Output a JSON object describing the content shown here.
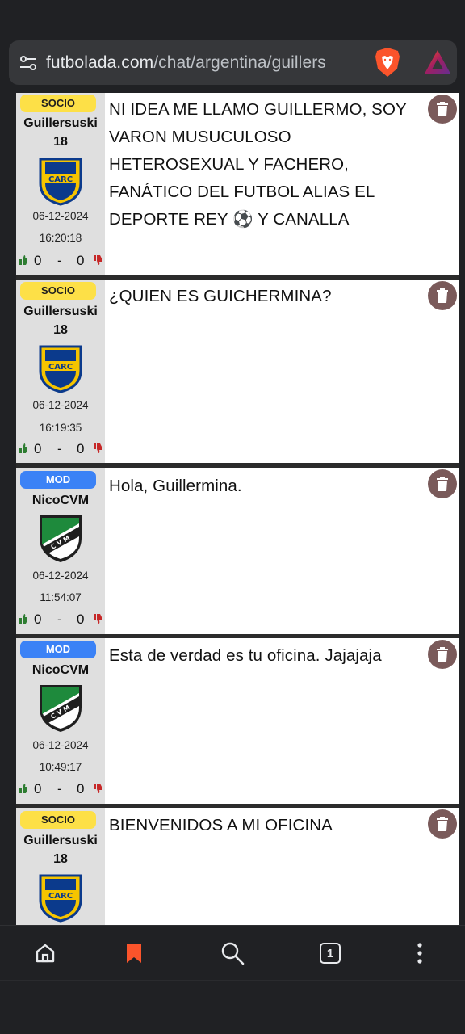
{
  "browser": {
    "url_host": "futbolada.com",
    "url_path": "/chat/argentina/guillers",
    "tab_count": "1",
    "icons": [
      "tune-icon",
      "brave-shields-icon",
      "brave-rewards-icon",
      "home-icon",
      "bookmark-icon",
      "search-icon",
      "tabs-icon",
      "more-icon"
    ],
    "accent_color": "#fb542b"
  },
  "messages": [
    {
      "badge": "SOCIO",
      "badge_type": "socio",
      "username_line1": "Guillersuski",
      "username_line2": "18",
      "crest": "rosario-central-crest",
      "date": "06-12-2024",
      "time": "16:20:18",
      "likes": "0",
      "dash": "-",
      "dislikes": "0",
      "text": "NI IDEA ME LLAMO GUILLERMO, SOY VARON MUSUCULOSO HETEROSEXUAL Y FACHERO, FANÁTICO DEL FUTBOL ALIAS EL DEPORTE REY ⚽ Y CANALLA"
    },
    {
      "badge": "SOCIO",
      "badge_type": "socio",
      "username_line1": "Guillersuski",
      "username_line2": "18",
      "crest": "rosario-central-crest",
      "date": "06-12-2024",
      "time": "16:19:35",
      "likes": "0",
      "dash": "-",
      "dislikes": "0",
      "text": "¿QUIEN ES GUICHERMINA?"
    },
    {
      "badge": "MOD",
      "badge_type": "mod",
      "username_line1": "NicoCVM",
      "username_line2": "",
      "crest": "cvm-crest",
      "date": "06-12-2024",
      "time": "11:54:07",
      "likes": "0",
      "dash": "-",
      "dislikes": "0",
      "text": "Hola, Guillermina."
    },
    {
      "badge": "MOD",
      "badge_type": "mod",
      "username_line1": "NicoCVM",
      "username_line2": "",
      "crest": "cvm-crest",
      "date": "06-12-2024",
      "time": "10:49:17",
      "likes": "0",
      "dash": "-",
      "dislikes": "0",
      "text": "Esta de verdad es tu oficina. Jajajaja"
    },
    {
      "badge": "SOCIO",
      "badge_type": "socio",
      "username_line1": "Guillersuski",
      "username_line2": "18",
      "crest": "rosario-central-crest",
      "text": "BIENVENIDOS A MI OFICINA"
    }
  ]
}
